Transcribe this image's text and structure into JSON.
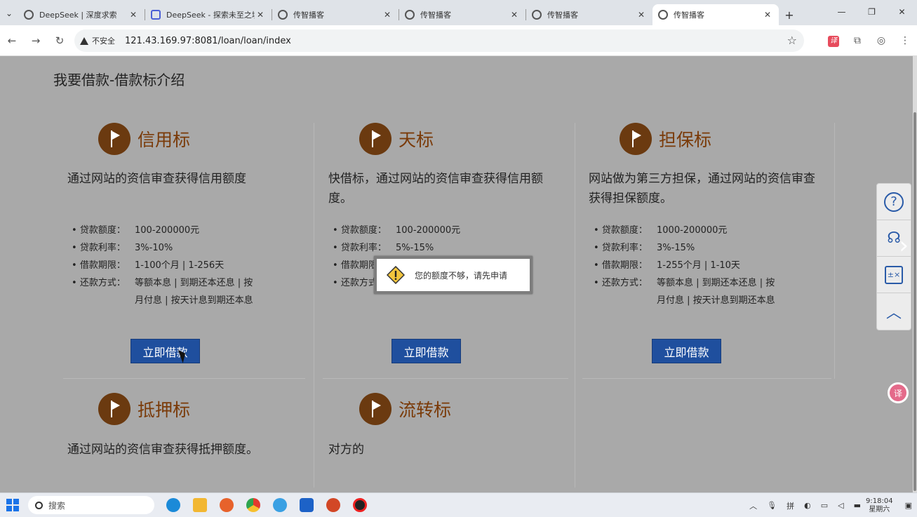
{
  "browser": {
    "tabs": [
      {
        "label": "DeepSeek | 深度求索",
        "favicon": "globe-icon",
        "active": false
      },
      {
        "label": "DeepSeek - 探索未至之境",
        "favicon": "deepseek-icon",
        "active": false
      },
      {
        "label": "传智播客",
        "favicon": "globe-icon",
        "active": false
      },
      {
        "label": "传智播客",
        "favicon": "globe-icon",
        "active": false
      },
      {
        "label": "传智播客",
        "favicon": "globe-icon",
        "active": false
      },
      {
        "label": "传智播客",
        "favicon": "globe-icon",
        "active": true
      }
    ],
    "security_label": "不安全",
    "url": "121.43.169.97:8081/loan/loan/index"
  },
  "page": {
    "title": "我要借款-借款标介绍",
    "cards": [
      {
        "title": "信用标",
        "description": "通过网站的资信审查获得信用额度",
        "specs": [
          {
            "key": "贷款额度：",
            "value": "100-200000元"
          },
          {
            "key": "贷款利率：",
            "value": "3%-10%"
          },
          {
            "key": "借款期限：",
            "value": "1-100个月 | 1-256天"
          },
          {
            "key": "还款方式：",
            "value": "等额本息 | 到期还本还息 | 按月付息 | 按天计息到期还本息"
          }
        ],
        "button": "立即借款"
      },
      {
        "title": "天标",
        "description": "快借标，通过网站的资信审查获得信用额度。",
        "specs": [
          {
            "key": "贷款额度：",
            "value": "100-200000元"
          },
          {
            "key": "贷款利率：",
            "value": "5%-15%"
          },
          {
            "key": "借款期限：",
            "value": ""
          },
          {
            "key": "还款方式：",
            "value": ""
          }
        ],
        "button": "立即借款"
      },
      {
        "title": "担保标",
        "description": "网站做为第三方担保，通过网站的资信审查获得担保额度。",
        "specs": [
          {
            "key": "贷款额度：",
            "value": "1000-200000元"
          },
          {
            "key": "贷款利率：",
            "value": "3%-15%"
          },
          {
            "key": "借款期限：",
            "value": "1-255个月 | 1-10天"
          },
          {
            "key": "还款方式：",
            "value": "等额本息 | 到期还本还息 | 按月付息 | 按天计息到期还本息"
          }
        ],
        "button": "立即借款"
      },
      {
        "title": "抵押标",
        "description": "通过网站的资信审查获得抵押额度。"
      },
      {
        "title": "流转标",
        "description": "对方的"
      }
    ],
    "dialog": {
      "message": "您的额度不够，请先申请",
      "icon": "warning-icon"
    }
  },
  "taskbar": {
    "search_placeholder": "搜索",
    "time": "9:18:04",
    "date": "星期六"
  },
  "colors": {
    "button_bg": "#1f4f9e",
    "card_title": "#7a3a08",
    "flag_circle": "#6b3a10",
    "page_overlay": "#a9a9a9"
  }
}
